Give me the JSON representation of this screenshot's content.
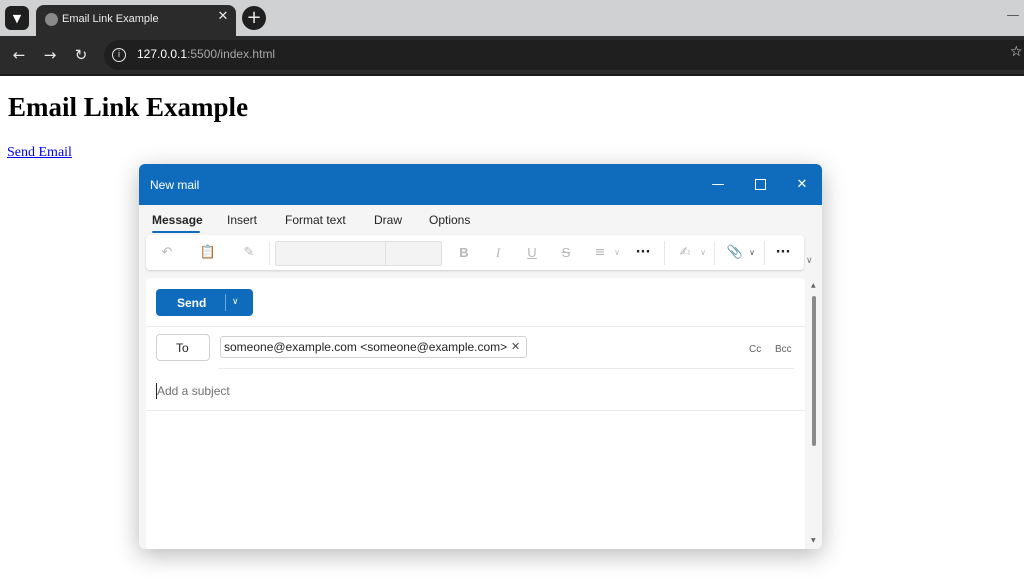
{
  "browser": {
    "tab_title": "Email Link Example",
    "tab_close": "✕",
    "new_tab": "+",
    "url_host": "127.0.0.1",
    "url_path": ":5500/index.html"
  },
  "page": {
    "heading": "Email Link Example",
    "link_text": "Send Email"
  },
  "mail": {
    "window_title": "New mail",
    "ribbon_tabs": [
      "Message",
      "Insert",
      "Format text",
      "Draw",
      "Options"
    ],
    "active_tab": "Message",
    "send_label": "Send",
    "to_label": "To",
    "recipient": "someone@example.com <someone@example.com>",
    "cc_label": "Cc",
    "bcc_label": "Bcc",
    "subject_placeholder": "Add a subject",
    "accent_color": "#0f6cbd"
  }
}
